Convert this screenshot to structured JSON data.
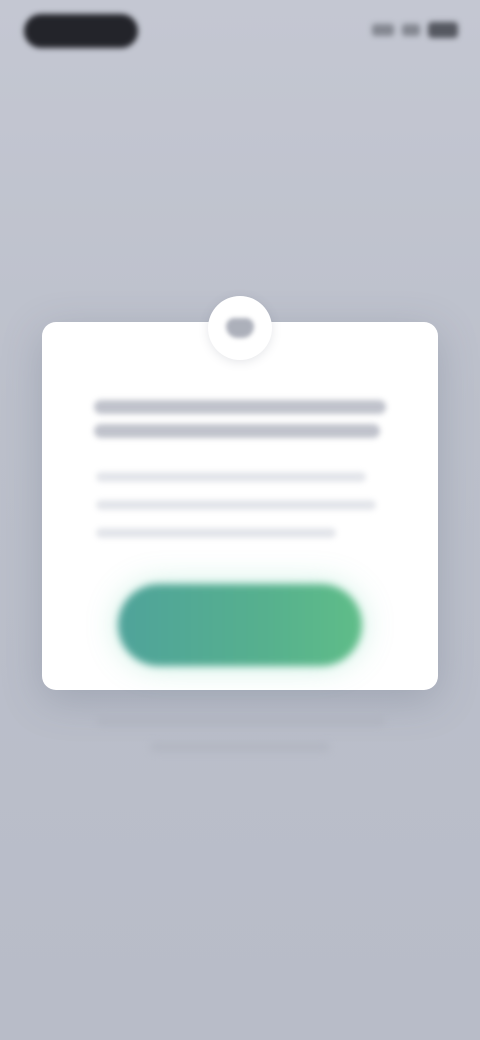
{
  "status_bar": {
    "time": "",
    "battery": ""
  },
  "dialog": {
    "title": "",
    "message": "",
    "primary_button_label": "",
    "footnote": ""
  },
  "colors": {
    "backdrop": "#bcc0cb",
    "dialog_background": "#ffffff",
    "button_gradient_start": "#4fa39a",
    "button_gradient_end": "#5fbd88"
  }
}
